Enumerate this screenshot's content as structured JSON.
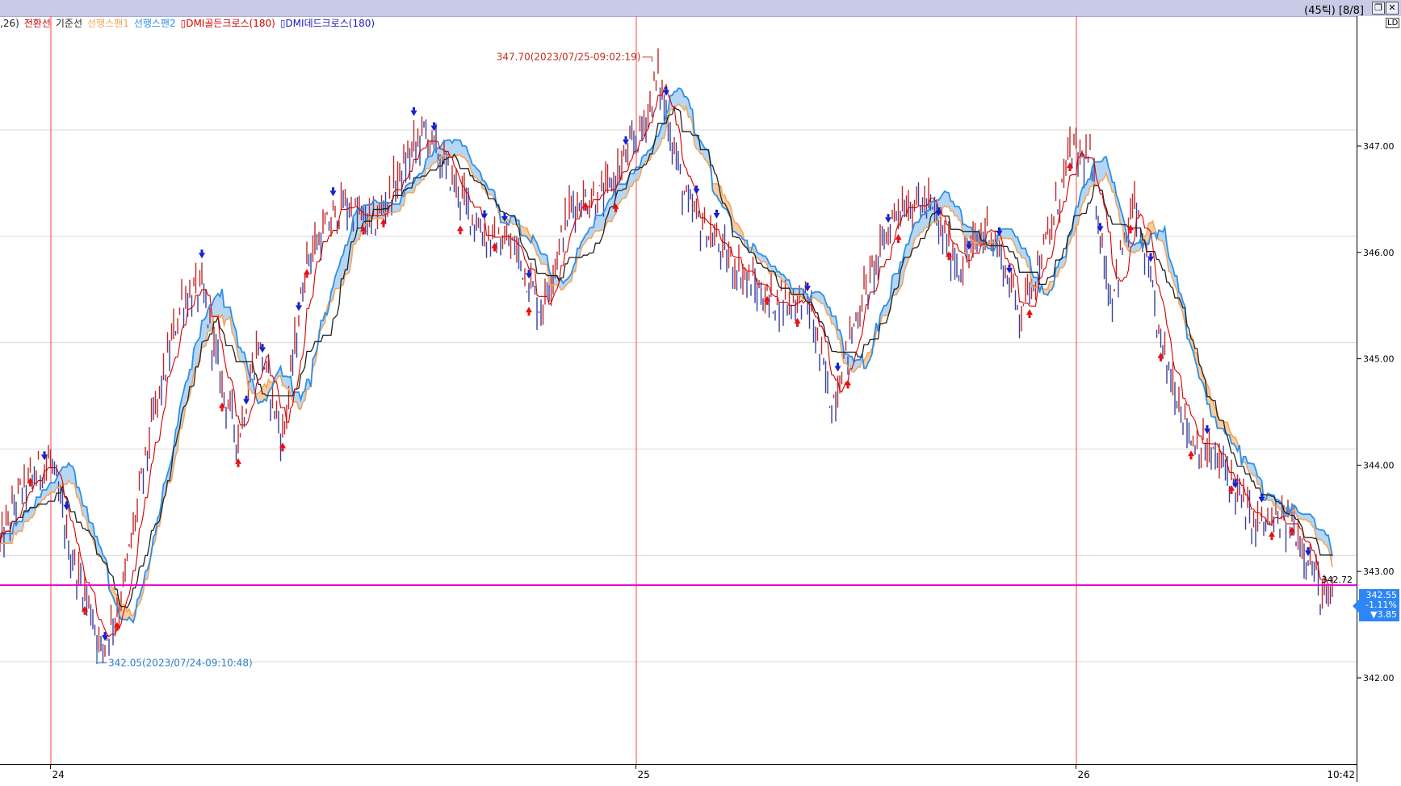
{
  "window": {
    "title": "(45틱) [8/8]",
    "btn_restore": "❐",
    "btn_close": "✕",
    "axis_corner": "LD"
  },
  "legend": [
    {
      "label": ",26)",
      "color": "#222222"
    },
    {
      "label": "전환선",
      "color": "#d40000"
    },
    {
      "label": "기준선",
      "color": "#222222"
    },
    {
      "label": "선행스팬1",
      "color": "#f2a55a"
    },
    {
      "label": "선행스팬2",
      "color": "#2f8fe6"
    },
    {
      "label": "▯DMI골든크로스(180)",
      "color": "#d40000"
    },
    {
      "label": "▯DMI데드크로스(180)",
      "color": "#1a1ab8"
    }
  ],
  "chart_data": {
    "type": "line",
    "title": "",
    "xlabel": "",
    "ylabel": "",
    "ylim": [
      341.5,
      347.8
    ],
    "y_ticks": [
      "347.00",
      "346.00",
      "345.00",
      "344.00",
      "343.00",
      "342.00"
    ],
    "y_tick_values": [
      347,
      346,
      345,
      344,
      343,
      342
    ],
    "x_ticks": [
      "24",
      "25",
      "26"
    ],
    "x_tick_index": [
      25,
      315,
      533
    ],
    "time_label": "10:42",
    "n_bars": 665,
    "keypoints": [
      [
        0,
        343.1
      ],
      [
        10,
        343.6
      ],
      [
        25,
        343.9
      ],
      [
        35,
        343.0
      ],
      [
        45,
        342.5
      ],
      [
        50,
        342.1
      ],
      [
        60,
        342.6
      ],
      [
        75,
        344.2
      ],
      [
        90,
        345.4
      ],
      [
        100,
        345.5
      ],
      [
        110,
        344.6
      ],
      [
        118,
        344.1
      ],
      [
        128,
        345.0
      ],
      [
        140,
        344.1
      ],
      [
        152,
        345.8
      ],
      [
        170,
        346.3
      ],
      [
        185,
        346.1
      ],
      [
        210,
        347.0
      ],
      [
        225,
        346.5
      ],
      [
        240,
        346.0
      ],
      [
        255,
        345.9
      ],
      [
        268,
        345.3
      ],
      [
        283,
        346.3
      ],
      [
        300,
        346.4
      ],
      [
        318,
        347.0
      ],
      [
        326,
        347.5
      ],
      [
        340,
        346.3
      ],
      [
        360,
        345.8
      ],
      [
        380,
        345.4
      ],
      [
        400,
        345.4
      ],
      [
        412,
        344.4
      ],
      [
        425,
        345.3
      ],
      [
        445,
        346.3
      ],
      [
        460,
        346.3
      ],
      [
        475,
        345.7
      ],
      [
        490,
        346.1
      ],
      [
        505,
        345.3
      ],
      [
        520,
        346.0
      ],
      [
        530,
        346.8
      ],
      [
        540,
        346.7
      ],
      [
        550,
        345.4
      ],
      [
        562,
        346.3
      ],
      [
        575,
        345.0
      ],
      [
        590,
        344.1
      ],
      [
        608,
        343.8
      ],
      [
        620,
        343.3
      ],
      [
        640,
        343.3
      ],
      [
        648,
        343.0
      ],
      [
        655,
        342.6
      ],
      [
        660,
        342.55
      ]
    ],
    "series": [
      {
        "name": "전환선",
        "color": "#d40000"
      },
      {
        "name": "기준선",
        "color": "#222222"
      },
      {
        "name": "선행스팬1",
        "color": "#f2a55a"
      },
      {
        "name": "선행스팬2",
        "color": "#2f8fe6"
      }
    ],
    "high_annotation": {
      "label": "347.70(2023/07/25-09:02:19)",
      "index": 323,
      "value": 347.7
    },
    "low_annotation": {
      "label": "342.05(2023/07/24-09:10:48)",
      "index": 48,
      "value": 342.05
    },
    "horizontal_line": {
      "value": 342.72,
      "label": "342.72",
      "color": "#ee00cc"
    },
    "current": {
      "price": "342.55",
      "change_pct": "-1.11%",
      "change": "▼3.85",
      "value": 342.55
    },
    "golden_cross_color": "#e81010",
    "dead_cross_color": "#1420d0",
    "golden_cross_index": [
      15,
      42,
      58,
      110,
      118,
      140,
      152,
      180,
      190,
      228,
      245,
      262,
      290,
      305,
      380,
      395,
      420,
      445,
      470,
      510,
      530,
      560,
      575,
      590,
      610,
      630,
      640
    ],
    "dead_cross_index": [
      22,
      33,
      52,
      100,
      122,
      130,
      148,
      165,
      205,
      215,
      240,
      250,
      262,
      310,
      330,
      345,
      355,
      400,
      415,
      440,
      465,
      480,
      495,
      500,
      545,
      570,
      598,
      612,
      625,
      648
    ]
  }
}
